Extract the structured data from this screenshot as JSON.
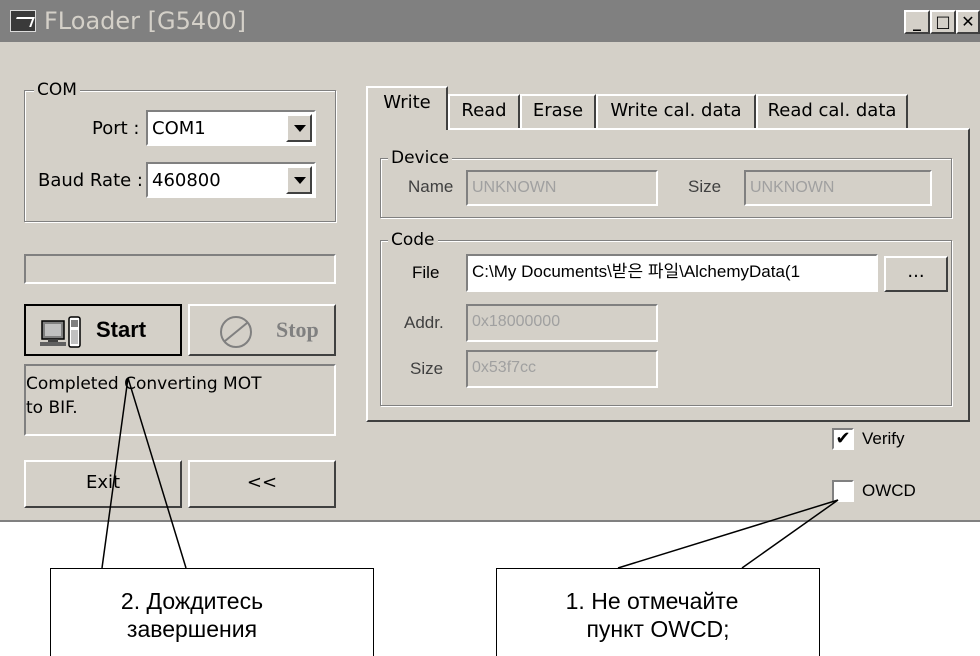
{
  "window": {
    "title": "FLoader [G5400]",
    "min_glyph": "_",
    "max_glyph": "□",
    "close_glyph": "✕"
  },
  "com": {
    "legend": "COM",
    "port_label": "Port :",
    "port_value": "COM1",
    "baud_label": "Baud Rate :",
    "baud_value": "460800"
  },
  "buttons": {
    "start": "Start",
    "stop": "Stop",
    "exit": "Exit",
    "back": "<<",
    "browse": "..."
  },
  "status_message": "Completed Converting MOT to BIF.",
  "tabs": [
    {
      "label": "Write"
    },
    {
      "label": "Read"
    },
    {
      "label": "Erase"
    },
    {
      "label": "Write cal. data"
    },
    {
      "label": "Read cal. data"
    }
  ],
  "device": {
    "legend": "Device",
    "name_label": "Name",
    "name_value": "UNKNOWN",
    "size_label": "Size",
    "size_value": "UNKNOWN"
  },
  "code": {
    "legend": "Code",
    "file_label": "File",
    "file_value": "C:\\My Documents\\받은 파일\\AlchemyData(1",
    "addr_label": "Addr.",
    "addr_value": "0x18000000",
    "size_label": "Size",
    "size_value": "0x53f7cc"
  },
  "options": {
    "verify_label": "Verify",
    "verify_checked": true,
    "owcd_label": "OWCD",
    "owcd_checked": false
  },
  "callouts": {
    "left_line1": "2. Дождитесь",
    "left_line2": "завершения",
    "right_line1": "1. Не отмечайте",
    "right_line2": "пункт OWCD;"
  }
}
